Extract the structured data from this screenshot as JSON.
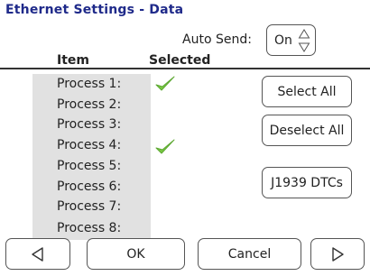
{
  "title": "Ethernet Settings - Data",
  "auto_send": {
    "label": "Auto Send:",
    "value": "On"
  },
  "columns": {
    "item": "Item",
    "selected": "Selected"
  },
  "processes": [
    {
      "label": "Process 1:",
      "selected": true
    },
    {
      "label": "Process 2:",
      "selected": false
    },
    {
      "label": "Process 3:",
      "selected": false
    },
    {
      "label": "Process 4:",
      "selected": true
    },
    {
      "label": "Process 5:",
      "selected": false
    },
    {
      "label": "Process 6:",
      "selected": false
    },
    {
      "label": "Process 7:",
      "selected": false
    },
    {
      "label": "Process 8:",
      "selected": false
    }
  ],
  "buttons": {
    "select_all": "Select All",
    "deselect_all": "Deselect All",
    "j1939_dtcs": "J1939 DTCs",
    "ok": "OK",
    "cancel": "Cancel"
  },
  "icons": {
    "check": "checkmark-icon",
    "prev": "left-triangle-icon",
    "next": "right-triangle-icon",
    "spinner": "up-down-spinner-icon"
  },
  "colors": {
    "title": "#1f2a8a",
    "check": "#7ac943",
    "panel": "#e1e1e1"
  }
}
